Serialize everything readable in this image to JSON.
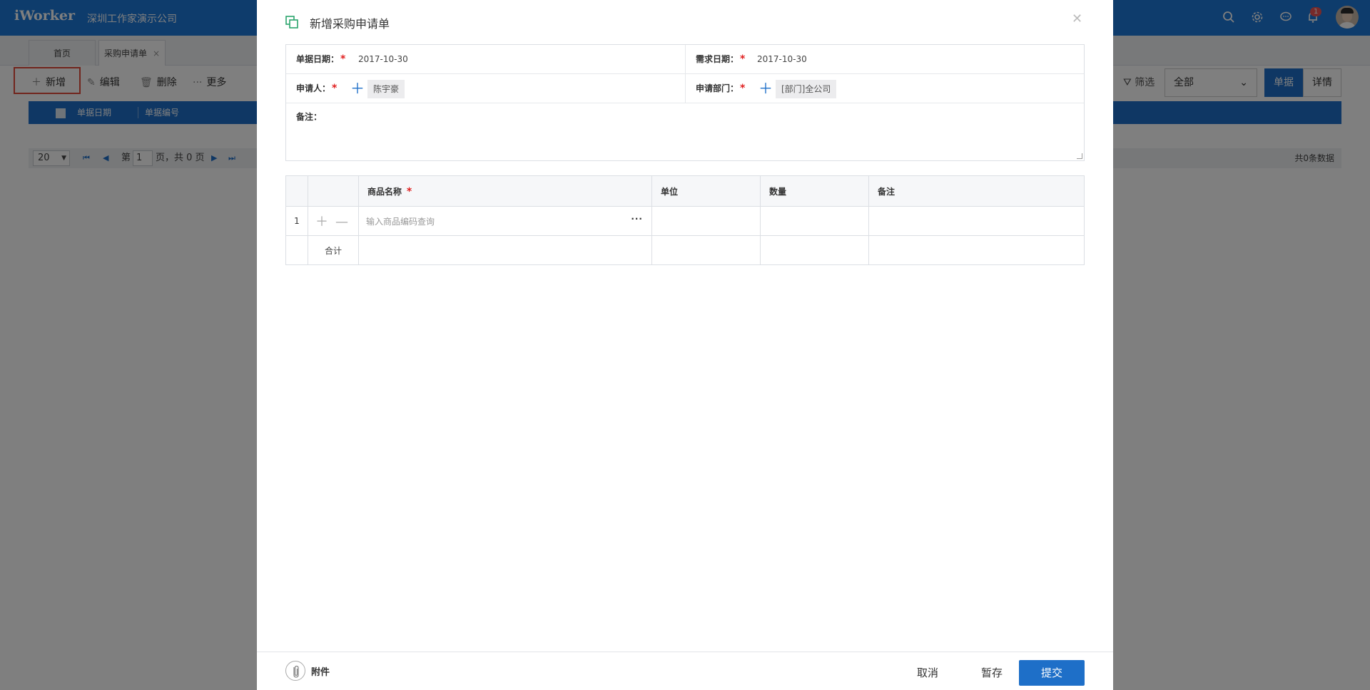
{
  "app": {
    "logo": "iWorker",
    "company": "深圳工作家演示公司",
    "notification_count": "1"
  },
  "tabs": [
    {
      "label": "首页"
    },
    {
      "label": "采购申请单",
      "close": "×"
    }
  ],
  "toolbar": {
    "add": "新增",
    "edit": "编辑",
    "delete": "删除",
    "more": "更多"
  },
  "grid": {
    "columns": [
      "单据日期",
      "单据编号"
    ]
  },
  "pager": {
    "page_size": "20",
    "page_prefix": "第",
    "page": "1",
    "page_suffix": "页，共 0 页",
    "total": "共0条数据"
  },
  "filter": {
    "label": "筛选",
    "select_value": "全部",
    "view_doc": "单据",
    "view_detail": "详情"
  },
  "modal": {
    "title": "新增采购申请单",
    "fields": {
      "doc_date_label": "单据日期：",
      "doc_date_value": "2017-10-30",
      "need_date_label": "需求日期：",
      "need_date_value": "2017-10-30",
      "applicant_label": "申请人：",
      "applicant_value": "陈宇豪",
      "dept_label": "申请部门：",
      "dept_value": "[部门]全公司",
      "remark_label": "备注："
    },
    "table": {
      "headers": [
        "商品名称",
        "单位",
        "数量",
        "备注"
      ],
      "rows": [
        {
          "index": "1",
          "product_placeholder": "输入商品编码查询"
        }
      ],
      "summary_label": "合计"
    },
    "footer": {
      "attachment": "附件",
      "cancel": "取消",
      "save_draft": "暂存",
      "submit": "提交"
    }
  },
  "colors": {
    "primary": "#1e6fc8",
    "topbar": "#1d78d8",
    "required": "#e02020",
    "highlight": "#e24b3a"
  }
}
